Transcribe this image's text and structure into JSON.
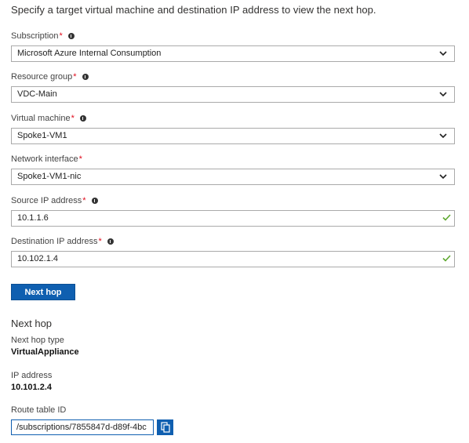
{
  "intro": "Specify a target virtual machine and destination IP address to view the next hop.",
  "fields": {
    "subscription": {
      "label": "Subscription",
      "value": "Microsoft Azure Internal Consumption"
    },
    "resource_group": {
      "label": "Resource group",
      "value": "VDC-Main"
    },
    "virtual_machine": {
      "label": "Virtual machine",
      "value": "Spoke1-VM1"
    },
    "network_interface": {
      "label": "Network interface",
      "value": "Spoke1-VM1-nic"
    },
    "source_ip": {
      "label": "Source IP address",
      "value": "10.1.1.6"
    },
    "destination_ip": {
      "label": "Destination IP address",
      "value": "10.102.1.4"
    }
  },
  "required_marker": "*",
  "next_hop_button": "Next hop",
  "result": {
    "title": "Next hop",
    "type_label": "Next hop type",
    "type_value": "VirtualAppliance",
    "ip_label": "IP address",
    "ip_value": "10.101.2.4",
    "route_label": "Route table ID",
    "route_value": "/subscriptions/7855847d-d89f-4bc"
  },
  "colors": {
    "accent": "#0f5fb0",
    "required": "#e00b1c",
    "valid_check": "#5ea82f"
  },
  "icons": {
    "info": "info-icon",
    "dropdown": "chevron-down-icon",
    "valid": "checkmark-icon",
    "copy": "copy-icon"
  }
}
